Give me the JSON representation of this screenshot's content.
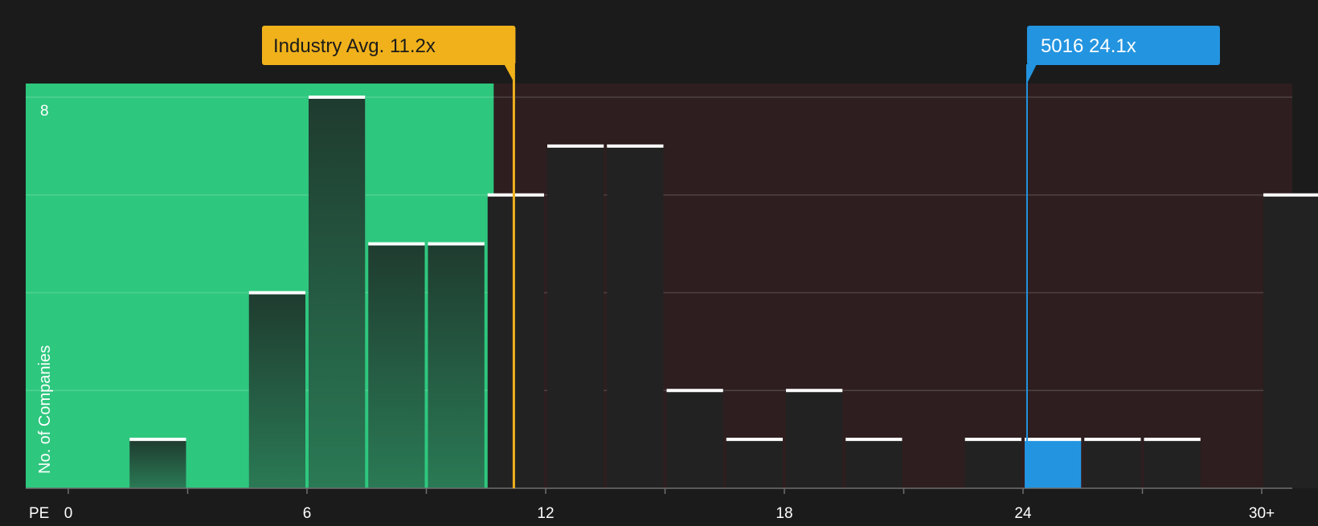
{
  "chart_data": {
    "type": "bar",
    "xlabel": "PE",
    "ylabel": "No. of Companies",
    "x_tick_labels": [
      "0",
      "6",
      "12",
      "18",
      "24",
      "30+"
    ],
    "y_tick_labels": [
      "8"
    ],
    "ylim": [
      0,
      8
    ],
    "grid": true,
    "bins": [
      {
        "x0": 0.0,
        "x1": 1.5,
        "value": 0
      },
      {
        "x0": 1.5,
        "x1": 3.0,
        "value": 1
      },
      {
        "x0": 3.0,
        "x1": 4.5,
        "value": 0
      },
      {
        "x0": 4.5,
        "x1": 6.0,
        "value": 4
      },
      {
        "x0": 6.0,
        "x1": 7.5,
        "value": 8
      },
      {
        "x0": 7.5,
        "x1": 9.0,
        "value": 5
      },
      {
        "x0": 9.0,
        "x1": 10.5,
        "value": 5
      },
      {
        "x0": 10.5,
        "x1": 12.0,
        "value": 6
      },
      {
        "x0": 12.0,
        "x1": 13.5,
        "value": 7
      },
      {
        "x0": 13.5,
        "x1": 15.0,
        "value": 7
      },
      {
        "x0": 15.0,
        "x1": 16.5,
        "value": 2
      },
      {
        "x0": 16.5,
        "x1": 18.0,
        "value": 1
      },
      {
        "x0": 18.0,
        "x1": 19.5,
        "value": 2
      },
      {
        "x0": 19.5,
        "x1": 21.0,
        "value": 1
      },
      {
        "x0": 21.0,
        "x1": 22.5,
        "value": 0
      },
      {
        "x0": 22.5,
        "x1": 24.0,
        "value": 1
      },
      {
        "x0": 24.0,
        "x1": 25.5,
        "value": 1,
        "highlight": true
      },
      {
        "x0": 25.5,
        "x1": 27.0,
        "value": 1
      },
      {
        "x0": 27.0,
        "x1": 28.5,
        "value": 1
      },
      {
        "x0": 28.5,
        "x1": 30.0,
        "value": 0
      },
      {
        "x0": 30.0,
        "x1": 31.5,
        "value": 6
      }
    ],
    "annotations": [
      {
        "label": "Industry Avg. 11.2x",
        "x": 11.2,
        "color": "#F0B11B"
      },
      {
        "label": "5016 24.1x",
        "x": 24.1,
        "color": "#2394E0"
      }
    ],
    "colors": {
      "background": "#1B1B1B",
      "undervalued_zone": "#2EC77E",
      "overvalued_zone": "#2E1E1F",
      "bar_dark": "#222222",
      "bar_cap": "#FFFFFF",
      "highlight": "#2394E0",
      "industry": "#F0B11B",
      "text": "#FFFFFF"
    }
  }
}
